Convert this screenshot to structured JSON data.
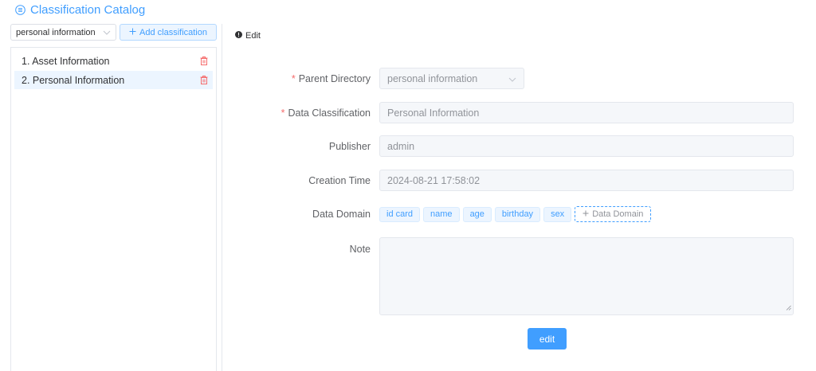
{
  "header": {
    "title": "Classification Catalog",
    "icon": "list-circle-icon"
  },
  "toolbar": {
    "select_value": "personal information",
    "add_label": "Add classification",
    "add_icon": "plus"
  },
  "tree": {
    "items": [
      {
        "label": "1. Asset Information",
        "active": false
      },
      {
        "label": "2. Personal Information",
        "active": true
      }
    ]
  },
  "edit": {
    "heading": "Edit",
    "fields": {
      "parent_directory": {
        "label": "Parent Directory",
        "required": true,
        "value": "personal information"
      },
      "data_classification": {
        "label": "Data Classification",
        "required": true,
        "value": "Personal Information"
      },
      "publisher": {
        "label": "Publisher",
        "value": "admin"
      },
      "creation_time": {
        "label": "Creation Time",
        "value": "2024-08-21 17:58:02"
      },
      "data_domain": {
        "label": "Data Domain",
        "tags": [
          "id card",
          "name",
          "age",
          "birthday",
          "sex"
        ],
        "add_label": "Data Domain"
      },
      "note": {
        "label": "Note",
        "value": ""
      }
    },
    "submit_label": "edit"
  },
  "colors": {
    "primary": "#409eff",
    "danger": "#f56c6c",
    "tag_bg": "#ecf5ff",
    "disabled_bg": "#f5f7fa"
  }
}
